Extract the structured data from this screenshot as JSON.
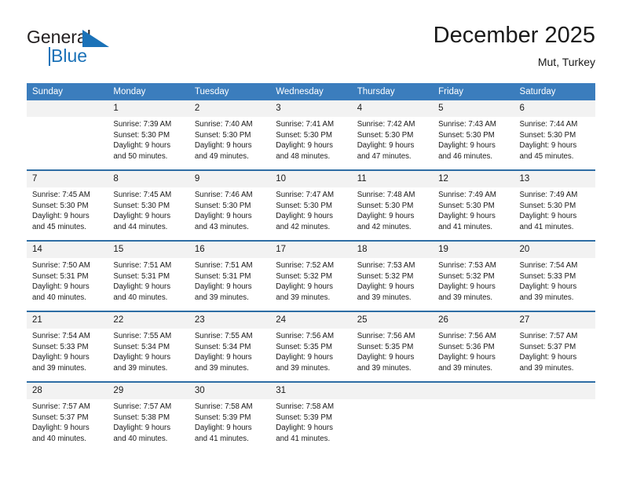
{
  "brand": {
    "line1": "General",
    "line2": "Blue",
    "triangle_color": "#1b72b8"
  },
  "header": {
    "title": "December 2025",
    "subtitle": "Mut, Turkey"
  },
  "colors": {
    "header_blue": "#3b7dbd",
    "week_divider": "#2e6da4",
    "daynum_bg": "#f2f2f2",
    "text": "#1a1a1a"
  },
  "weekday_headers": [
    "Sunday",
    "Monday",
    "Tuesday",
    "Wednesday",
    "Thursday",
    "Friday",
    "Saturday"
  ],
  "weeks": [
    [
      {
        "day": "",
        "sunrise": "",
        "sunset": "",
        "daylight_line1": "",
        "daylight_line2": ""
      },
      {
        "day": "1",
        "sunrise": "Sunrise: 7:39 AM",
        "sunset": "Sunset: 5:30 PM",
        "daylight_line1": "Daylight: 9 hours",
        "daylight_line2": "and 50 minutes."
      },
      {
        "day": "2",
        "sunrise": "Sunrise: 7:40 AM",
        "sunset": "Sunset: 5:30 PM",
        "daylight_line1": "Daylight: 9 hours",
        "daylight_line2": "and 49 minutes."
      },
      {
        "day": "3",
        "sunrise": "Sunrise: 7:41 AM",
        "sunset": "Sunset: 5:30 PM",
        "daylight_line1": "Daylight: 9 hours",
        "daylight_line2": "and 48 minutes."
      },
      {
        "day": "4",
        "sunrise": "Sunrise: 7:42 AM",
        "sunset": "Sunset: 5:30 PM",
        "daylight_line1": "Daylight: 9 hours",
        "daylight_line2": "and 47 minutes."
      },
      {
        "day": "5",
        "sunrise": "Sunrise: 7:43 AM",
        "sunset": "Sunset: 5:30 PM",
        "daylight_line1": "Daylight: 9 hours",
        "daylight_line2": "and 46 minutes."
      },
      {
        "day": "6",
        "sunrise": "Sunrise: 7:44 AM",
        "sunset": "Sunset: 5:30 PM",
        "daylight_line1": "Daylight: 9 hours",
        "daylight_line2": "and 45 minutes."
      }
    ],
    [
      {
        "day": "7",
        "sunrise": "Sunrise: 7:45 AM",
        "sunset": "Sunset: 5:30 PM",
        "daylight_line1": "Daylight: 9 hours",
        "daylight_line2": "and 45 minutes."
      },
      {
        "day": "8",
        "sunrise": "Sunrise: 7:45 AM",
        "sunset": "Sunset: 5:30 PM",
        "daylight_line1": "Daylight: 9 hours",
        "daylight_line2": "and 44 minutes."
      },
      {
        "day": "9",
        "sunrise": "Sunrise: 7:46 AM",
        "sunset": "Sunset: 5:30 PM",
        "daylight_line1": "Daylight: 9 hours",
        "daylight_line2": "and 43 minutes."
      },
      {
        "day": "10",
        "sunrise": "Sunrise: 7:47 AM",
        "sunset": "Sunset: 5:30 PM",
        "daylight_line1": "Daylight: 9 hours",
        "daylight_line2": "and 42 minutes."
      },
      {
        "day": "11",
        "sunrise": "Sunrise: 7:48 AM",
        "sunset": "Sunset: 5:30 PM",
        "daylight_line1": "Daylight: 9 hours",
        "daylight_line2": "and 42 minutes."
      },
      {
        "day": "12",
        "sunrise": "Sunrise: 7:49 AM",
        "sunset": "Sunset: 5:30 PM",
        "daylight_line1": "Daylight: 9 hours",
        "daylight_line2": "and 41 minutes."
      },
      {
        "day": "13",
        "sunrise": "Sunrise: 7:49 AM",
        "sunset": "Sunset: 5:30 PM",
        "daylight_line1": "Daylight: 9 hours",
        "daylight_line2": "and 41 minutes."
      }
    ],
    [
      {
        "day": "14",
        "sunrise": "Sunrise: 7:50 AM",
        "sunset": "Sunset: 5:31 PM",
        "daylight_line1": "Daylight: 9 hours",
        "daylight_line2": "and 40 minutes."
      },
      {
        "day": "15",
        "sunrise": "Sunrise: 7:51 AM",
        "sunset": "Sunset: 5:31 PM",
        "daylight_line1": "Daylight: 9 hours",
        "daylight_line2": "and 40 minutes."
      },
      {
        "day": "16",
        "sunrise": "Sunrise: 7:51 AM",
        "sunset": "Sunset: 5:31 PM",
        "daylight_line1": "Daylight: 9 hours",
        "daylight_line2": "and 39 minutes."
      },
      {
        "day": "17",
        "sunrise": "Sunrise: 7:52 AM",
        "sunset": "Sunset: 5:32 PM",
        "daylight_line1": "Daylight: 9 hours",
        "daylight_line2": "and 39 minutes."
      },
      {
        "day": "18",
        "sunrise": "Sunrise: 7:53 AM",
        "sunset": "Sunset: 5:32 PM",
        "daylight_line1": "Daylight: 9 hours",
        "daylight_line2": "and 39 minutes."
      },
      {
        "day": "19",
        "sunrise": "Sunrise: 7:53 AM",
        "sunset": "Sunset: 5:32 PM",
        "daylight_line1": "Daylight: 9 hours",
        "daylight_line2": "and 39 minutes."
      },
      {
        "day": "20",
        "sunrise": "Sunrise: 7:54 AM",
        "sunset": "Sunset: 5:33 PM",
        "daylight_line1": "Daylight: 9 hours",
        "daylight_line2": "and 39 minutes."
      }
    ],
    [
      {
        "day": "21",
        "sunrise": "Sunrise: 7:54 AM",
        "sunset": "Sunset: 5:33 PM",
        "daylight_line1": "Daylight: 9 hours",
        "daylight_line2": "and 39 minutes."
      },
      {
        "day": "22",
        "sunrise": "Sunrise: 7:55 AM",
        "sunset": "Sunset: 5:34 PM",
        "daylight_line1": "Daylight: 9 hours",
        "daylight_line2": "and 39 minutes."
      },
      {
        "day": "23",
        "sunrise": "Sunrise: 7:55 AM",
        "sunset": "Sunset: 5:34 PM",
        "daylight_line1": "Daylight: 9 hours",
        "daylight_line2": "and 39 minutes."
      },
      {
        "day": "24",
        "sunrise": "Sunrise: 7:56 AM",
        "sunset": "Sunset: 5:35 PM",
        "daylight_line1": "Daylight: 9 hours",
        "daylight_line2": "and 39 minutes."
      },
      {
        "day": "25",
        "sunrise": "Sunrise: 7:56 AM",
        "sunset": "Sunset: 5:35 PM",
        "daylight_line1": "Daylight: 9 hours",
        "daylight_line2": "and 39 minutes."
      },
      {
        "day": "26",
        "sunrise": "Sunrise: 7:56 AM",
        "sunset": "Sunset: 5:36 PM",
        "daylight_line1": "Daylight: 9 hours",
        "daylight_line2": "and 39 minutes."
      },
      {
        "day": "27",
        "sunrise": "Sunrise: 7:57 AM",
        "sunset": "Sunset: 5:37 PM",
        "daylight_line1": "Daylight: 9 hours",
        "daylight_line2": "and 39 minutes."
      }
    ],
    [
      {
        "day": "28",
        "sunrise": "Sunrise: 7:57 AM",
        "sunset": "Sunset: 5:37 PM",
        "daylight_line1": "Daylight: 9 hours",
        "daylight_line2": "and 40 minutes."
      },
      {
        "day": "29",
        "sunrise": "Sunrise: 7:57 AM",
        "sunset": "Sunset: 5:38 PM",
        "daylight_line1": "Daylight: 9 hours",
        "daylight_line2": "and 40 minutes."
      },
      {
        "day": "30",
        "sunrise": "Sunrise: 7:58 AM",
        "sunset": "Sunset: 5:39 PM",
        "daylight_line1": "Daylight: 9 hours",
        "daylight_line2": "and 41 minutes."
      },
      {
        "day": "31",
        "sunrise": "Sunrise: 7:58 AM",
        "sunset": "Sunset: 5:39 PM",
        "daylight_line1": "Daylight: 9 hours",
        "daylight_line2": "and 41 minutes."
      },
      {
        "day": "",
        "sunrise": "",
        "sunset": "",
        "daylight_line1": "",
        "daylight_line2": ""
      },
      {
        "day": "",
        "sunrise": "",
        "sunset": "",
        "daylight_line1": "",
        "daylight_line2": ""
      },
      {
        "day": "",
        "sunrise": "",
        "sunset": "",
        "daylight_line1": "",
        "daylight_line2": ""
      }
    ]
  ]
}
